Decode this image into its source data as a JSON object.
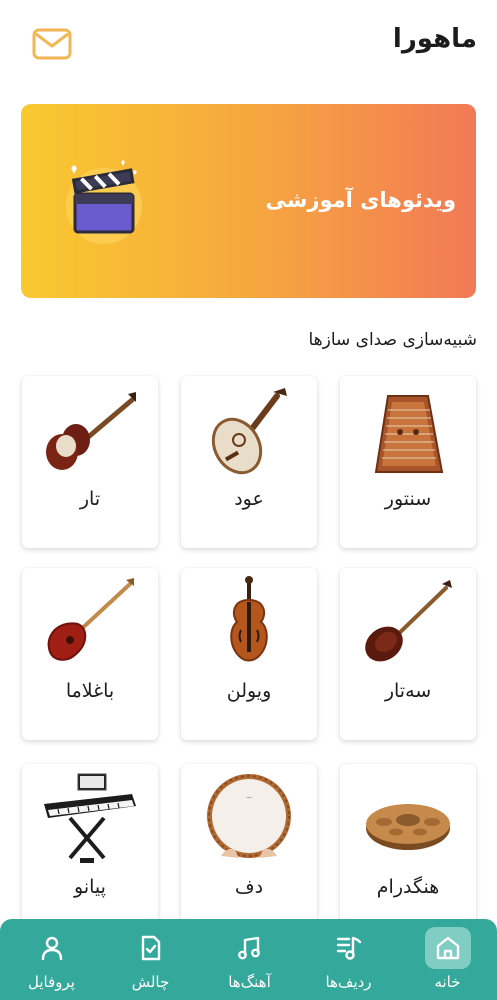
{
  "header": {
    "title": "ماهورا",
    "mail_icon": "mail-icon"
  },
  "banner": {
    "title": "ویدئوهای آموزشی",
    "icon": "clapperboard-icon"
  },
  "section": {
    "title": "شبیه‌سازی صدای سازها"
  },
  "instruments": [
    {
      "label": "سنتور",
      "icon": "santur-image"
    },
    {
      "label": "عود",
      "icon": "oud-image"
    },
    {
      "label": "تار",
      "icon": "tar-image"
    },
    {
      "label": "سه‌تار",
      "icon": "setar-image"
    },
    {
      "label": "ویولن",
      "icon": "violin-image"
    },
    {
      "label": "باغلاما",
      "icon": "baglama-image"
    },
    {
      "label": "هنگدرام",
      "icon": "handpan-image"
    },
    {
      "label": "دف",
      "icon": "daf-image"
    },
    {
      "label": "پیانو",
      "icon": "piano-image"
    }
  ],
  "nav": [
    {
      "label": "خانه",
      "icon": "home-icon",
      "active": true
    },
    {
      "label": "ردیف‌ها",
      "icon": "playlist-icon",
      "active": false
    },
    {
      "label": "آهنگ‌ها",
      "icon": "music-note-icon",
      "active": false
    },
    {
      "label": "چالش",
      "icon": "challenge-file-icon",
      "active": false
    },
    {
      "label": "پروفایل",
      "icon": "user-icon",
      "active": false
    }
  ],
  "colors": {
    "nav_bg": "#34a89a",
    "nav_active": "#7fcdc3",
    "banner_start": "#f9c92f",
    "banner_end": "#f27956",
    "mail": "#f2b654"
  }
}
